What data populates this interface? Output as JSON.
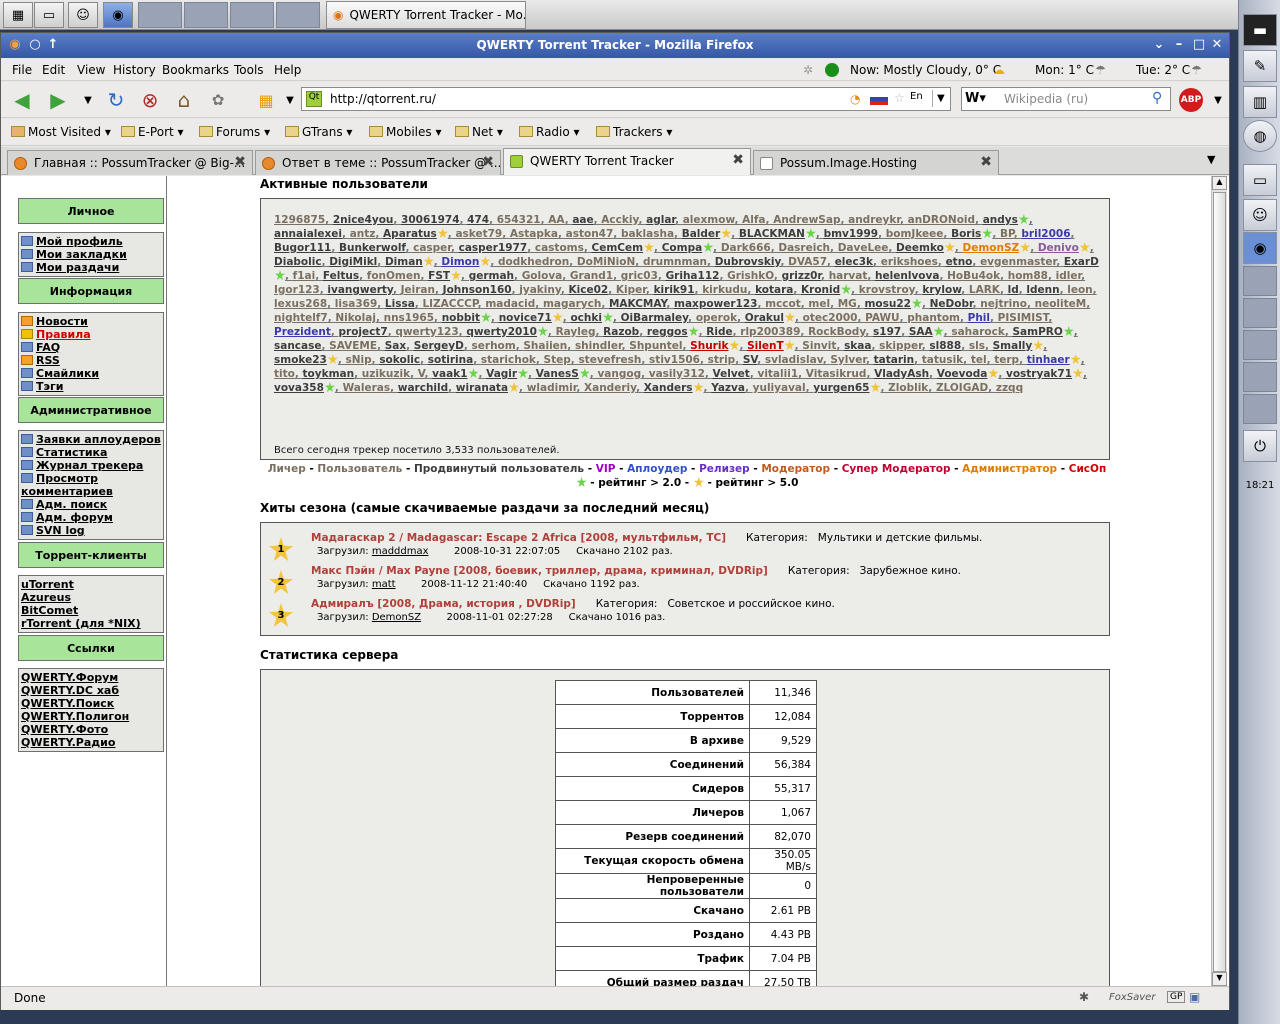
{
  "taskbar": {
    "window_label": "QWERTY Torrent Tracker - Mo..."
  },
  "window": {
    "title": "QWERTY Torrent Tracker - Mozilla Firefox"
  },
  "menu": [
    "File",
    "Edit",
    "View",
    "History",
    "Bookmarks",
    "Tools",
    "Help"
  ],
  "weather": {
    "now": "Now: Mostly Cloudy, 0° C",
    "mon": "Mon: 1° C",
    "tue": "Tue: 2° C"
  },
  "nav": {
    "url": "http://qtorrent.ru/",
    "search_placeholder": "Wikipedia (ru)"
  },
  "bookmarks": [
    "Most Visited",
    "E-Port",
    "Forums",
    "GTrans",
    "Mobiles",
    "Net",
    "Radio",
    "Trackers"
  ],
  "tabs": [
    {
      "label": "Главная :: PossumTracker @ Big-..."
    },
    {
      "label": "Ответ в теме :: PossumTracker @ ..."
    },
    {
      "label": "QWERTY Torrent Tracker"
    },
    {
      "label": "Possum.Image.Hosting"
    }
  ],
  "sidebar": {
    "sections": [
      {
        "title": "Личное",
        "items": [
          "Мой профиль",
          "Мои закладки",
          "Мои раздачи"
        ]
      },
      {
        "title": "Информация",
        "items": [
          "Новости",
          "Правила",
          "FAQ",
          "RSS",
          "Смайлики",
          "Тэги"
        ]
      },
      {
        "title": "Административное",
        "items": [
          "Заявки аплоудеров",
          "Статистика",
          "Журнал трекера",
          "Просмотр",
          "комментариев",
          "Адм. поиск",
          "Адм. форум",
          "SVN log"
        ]
      },
      {
        "title": "Торрент-клиенты",
        "items": [
          "uTorrent",
          "Azureus",
          "BitComet",
          "rTorrent (для *NIX)"
        ]
      },
      {
        "title": "Ссылки",
        "items": [
          "QWERTY.Форум",
          "QWERTY.DC хаб",
          "QWERTY.Поиск",
          "QWERTY.Полигон",
          "QWERTY.Фото",
          "QWERTY.Радио"
        ]
      }
    ]
  },
  "active_users": {
    "heading": "Активные пользователи",
    "users": [
      [
        "1296875",
        "g"
      ],
      [
        "2nice4you",
        "k"
      ],
      [
        "30061974",
        "k"
      ],
      [
        "474",
        "k"
      ],
      [
        "654321",
        "g"
      ],
      [
        "AA",
        "g"
      ],
      [
        "aae",
        "k"
      ],
      [
        "Acckiy",
        "g"
      ],
      [
        "aglar",
        "k"
      ],
      [
        "alexmow",
        "g"
      ],
      [
        "Alfa",
        "g"
      ],
      [
        "AndrewSap",
        "g"
      ],
      [
        "andreykr",
        "g"
      ],
      [
        "anDRONoid",
        "g"
      ],
      [
        "andys",
        "k"
      ],
      [
        "annaialexei",
        "k"
      ],
      [
        "antz",
        "g"
      ],
      [
        "Aparatus",
        "k"
      ],
      [
        "asket79",
        "g"
      ],
      [
        "Astapka",
        "g"
      ],
      [
        "aston47",
        "g"
      ],
      [
        "baklasha",
        "g"
      ],
      [
        "Balder",
        "k"
      ],
      [
        "BLACKMAN",
        "k"
      ],
      [
        "bmv1999",
        "k"
      ],
      [
        "bomJkeee",
        "g"
      ],
      [
        "Boris",
        "k"
      ],
      [
        "BP",
        "g"
      ],
      [
        "bril2006",
        "b"
      ],
      [
        "Bugor111",
        "k"
      ],
      [
        "Bunkerwolf",
        "k"
      ],
      [
        "casper",
        "g"
      ],
      [
        "casper1977",
        "k"
      ],
      [
        "castoms",
        "g"
      ],
      [
        "CemCem",
        "k"
      ],
      [
        "Compa",
        "k"
      ],
      [
        "Dark666",
        "g"
      ],
      [
        "Dasreich",
        "g"
      ],
      [
        "DaveLee",
        "g"
      ],
      [
        "Deemko",
        "k"
      ],
      [
        "DemonSZ",
        "o"
      ],
      [
        "Denivo",
        "v"
      ],
      [
        "Diabolic",
        "k"
      ],
      [
        "DigiMikl",
        "k"
      ],
      [
        "Diman",
        "k"
      ],
      [
        "Dimon",
        "b"
      ],
      [
        "dodkhedron",
        "g"
      ],
      [
        "DoMiNioN",
        "g"
      ],
      [
        "drumnman",
        "g"
      ],
      [
        "Dubrovskiy",
        "k"
      ],
      [
        "DVA57",
        "g"
      ],
      [
        "elec3k",
        "k"
      ],
      [
        "erikshoes",
        "g"
      ],
      [
        "etno",
        "k"
      ],
      [
        "evgenmaster",
        "g"
      ],
      [
        "ExarD",
        "k"
      ],
      [
        "f1ai",
        "g"
      ],
      [
        "Feltus",
        "k"
      ],
      [
        "fonOmen",
        "g"
      ],
      [
        "FST",
        "k"
      ],
      [
        "germah",
        "k"
      ],
      [
        "Golova",
        "g"
      ],
      [
        "Grand1",
        "g"
      ],
      [
        "gric03",
        "g"
      ],
      [
        "Griha112",
        "k"
      ],
      [
        "GrishkO",
        "g"
      ],
      [
        "grizz0r",
        "k"
      ],
      [
        "harvat",
        "g"
      ],
      [
        "helenlvova",
        "k"
      ],
      [
        "HoBu4ok",
        "g"
      ],
      [
        "hom88",
        "g"
      ],
      [
        "idler",
        "g"
      ],
      [
        "Igor123",
        "g"
      ],
      [
        "ivangwerty",
        "k"
      ],
      [
        "Jeiran",
        "g"
      ],
      [
        "Johnson160",
        "k"
      ],
      [
        "jyakiny",
        "g"
      ],
      [
        "Kice02",
        "k"
      ],
      [
        "Kiper",
        "g"
      ],
      [
        "kirik91",
        "k"
      ],
      [
        "kirkudu",
        "g"
      ],
      [
        "kotara",
        "k"
      ],
      [
        "Kronid",
        "k"
      ],
      [
        "krovstroy",
        "g"
      ],
      [
        "krylow",
        "k"
      ],
      [
        "LARK",
        "g"
      ],
      [
        "ld",
        "k"
      ],
      [
        "ldenn",
        "k"
      ],
      [
        "leon",
        "g"
      ],
      [
        "lexus268",
        "g"
      ],
      [
        "lisa369",
        "g"
      ],
      [
        "Lissa",
        "k"
      ],
      [
        "LIZACCCP",
        "g"
      ],
      [
        "madacid",
        "g"
      ],
      [
        "magarych",
        "g"
      ],
      [
        "MAKCMAY",
        "k"
      ],
      [
        "maxpower123",
        "k"
      ],
      [
        "mccot",
        "g"
      ],
      [
        "mel",
        "g"
      ],
      [
        "MG",
        "g"
      ],
      [
        "mosu22",
        "k"
      ],
      [
        "NeDobr",
        "k"
      ],
      [
        "nejtrino",
        "g"
      ],
      [
        "neoliteM",
        "g"
      ],
      [
        "nightelf7",
        "g"
      ],
      [
        "Nikolaj",
        "g"
      ],
      [
        "nns1965",
        "g"
      ],
      [
        "nobbit",
        "k"
      ],
      [
        "novice71",
        "k"
      ],
      [
        "ochki",
        "k"
      ],
      [
        "OiBarmaley",
        "k"
      ],
      [
        "operok",
        "g"
      ],
      [
        "Orakul",
        "k"
      ],
      [
        "otec2000",
        "g"
      ],
      [
        "PAWU",
        "g"
      ],
      [
        "phantom",
        "g"
      ],
      [
        "Phil",
        "b"
      ],
      [
        "PISIMIST",
        "g"
      ],
      [
        "Prezident",
        "b"
      ],
      [
        "project7",
        "k"
      ],
      [
        "qwerty123",
        "g"
      ],
      [
        "qwerty2010",
        "k"
      ],
      [
        "Rayleg",
        "g"
      ],
      [
        "Razob",
        "k"
      ],
      [
        "reggos",
        "k"
      ],
      [
        "Ride",
        "k"
      ],
      [
        "rlp200389",
        "g"
      ],
      [
        "RockBody",
        "g"
      ],
      [
        "s197",
        "k"
      ],
      [
        "SAA",
        "k"
      ],
      [
        "saharock",
        "g"
      ],
      [
        "SamPRO",
        "k"
      ],
      [
        "sancase",
        "k"
      ],
      [
        "SAVEME",
        "g"
      ],
      [
        "Sax",
        "k"
      ],
      [
        "SergeyD",
        "k"
      ],
      [
        "serhom",
        "g"
      ],
      [
        "Shaiien",
        "g"
      ],
      [
        "shindler",
        "g"
      ],
      [
        "Shpuntel",
        "g"
      ],
      [
        "Shurik",
        "rd"
      ],
      [
        "SilenT",
        "rd"
      ],
      [
        "Sinvit",
        "g"
      ],
      [
        "skaa",
        "k"
      ],
      [
        "skipper",
        "g"
      ],
      [
        "sl888",
        "k"
      ],
      [
        "sls",
        "g"
      ],
      [
        "Smally",
        "k"
      ],
      [
        "smoke23",
        "k"
      ],
      [
        "sNip",
        "g"
      ],
      [
        "sokolic",
        "k"
      ],
      [
        "sotirina",
        "k"
      ],
      [
        "starichok",
        "g"
      ],
      [
        "Step",
        "g"
      ],
      [
        "stevefresh",
        "g"
      ],
      [
        "stiv1506",
        "g"
      ],
      [
        "strip",
        "g"
      ],
      [
        "SV",
        "k"
      ],
      [
        "svladislav",
        "g"
      ],
      [
        "Sylver",
        "g"
      ],
      [
        "tatarin",
        "k"
      ],
      [
        "tatusik",
        "g"
      ],
      [
        "tel",
        "g"
      ],
      [
        "terp",
        "g"
      ],
      [
        "tinhaer",
        "b"
      ],
      [
        "tito",
        "g"
      ],
      [
        "toykman",
        "k"
      ],
      [
        "uzikuzik",
        "g"
      ],
      [
        "V",
        "g"
      ],
      [
        "vaak1",
        "k"
      ],
      [
        "Vagir",
        "k"
      ],
      [
        "VanesS",
        "k"
      ],
      [
        "vangog",
        "g"
      ],
      [
        "vasily312",
        "g"
      ],
      [
        "Velvet",
        "k"
      ],
      [
        "vitalii1",
        "g"
      ],
      [
        "Vitasikrud",
        "g"
      ],
      [
        "VladyAsh",
        "k"
      ],
      [
        "Voevoda",
        "k"
      ],
      [
        "vostryak71",
        "k"
      ],
      [
        "vova358",
        "k"
      ],
      [
        "Waleras",
        "g"
      ],
      [
        "warchild",
        "k"
      ],
      [
        "wiranata",
        "k"
      ],
      [
        "wladimir",
        "g"
      ],
      [
        "Xanderiy",
        "g"
      ],
      [
        "Xanders",
        "k"
      ],
      [
        "Yazva",
        "k"
      ],
      [
        "yuliyaval",
        "g"
      ],
      [
        "yurgen65",
        "k"
      ],
      [
        "Zloblik",
        "g"
      ],
      [
        "ZLOIGAD",
        "g"
      ],
      [
        "zzqq",
        "g"
      ]
    ],
    "total": "Всего сегодня трекер посетило 3,533 пользователей."
  },
  "legend": {
    "roles": [
      [
        "Личер",
        "#7a6f60"
      ],
      [
        "Пользователь",
        "#7a6f60"
      ],
      [
        "Продвинутый пользователь",
        "#3d3d3d"
      ],
      [
        "VIP",
        "#a000c8"
      ],
      [
        "Аплоудер",
        "#2f50c8"
      ],
      [
        "Релизер",
        "#6a2bd0"
      ],
      [
        "Модератор",
        "#c05a20"
      ],
      [
        "Супер Модератор",
        "#c00030"
      ],
      [
        "Администратор",
        "#e07a00"
      ],
      [
        "СисОп",
        "#d00000"
      ]
    ],
    "rating1": "- рейтинг > 2.0 -",
    "rating2": "- рейтинг > 5.0"
  },
  "hits": {
    "heading": "Хиты сезона (самые скачиваемые раздачи за последний месяц)",
    "items": [
      {
        "rank": "1",
        "title": "Мадагаскар 2 / Madagascar: Escape 2 Africa [2008, мультфильм, TC]",
        "cat_label": "Категория:",
        "category": "Мультики и детские фильмы.",
        "up_label": "Загрузил:",
        "uploader": "madddmax",
        "date": "2008-10-31 22:07:05",
        "downloads": "Скачано 2102 раз."
      },
      {
        "rank": "2",
        "title": "Макс Пэйн / Max Payne [2008, боевик, триллер, драма, криминал, DVDRip]",
        "cat_label": "Категория:",
        "category": "Зарубежное кино.",
        "up_label": "Загрузил:",
        "uploader": "matt",
        "date": "2008-11-12 21:40:40",
        "downloads": "Скачано 1192 раз."
      },
      {
        "rank": "3",
        "title": "Адмиралъ [2008, Драма, история , DVDRip]",
        "cat_label": "Категория:",
        "category": "Советское и российское кино.",
        "up_label": "Загрузил:",
        "uploader": "DemonSZ",
        "date": "2008-11-01 02:27:28",
        "downloads": "Скачано 1016 раз."
      }
    ]
  },
  "stats": {
    "heading": "Статистика сервера",
    "rows": [
      [
        "Пользователей",
        "11,346"
      ],
      [
        "Торрентов",
        "12,084"
      ],
      [
        "В архиве",
        "9,529"
      ],
      [
        "Соединений",
        "56,384"
      ],
      [
        "Сидеров",
        "55,317"
      ],
      [
        "Личеров",
        "1,067"
      ],
      [
        "Резерв соединений",
        "82,070"
      ],
      [
        "Текущая скорость обмена",
        "350.05 MB/s"
      ],
      [
        "Непроверенные пользователи",
        "0"
      ],
      [
        "Скачано",
        "2.61 PB"
      ],
      [
        "Роздано",
        "4.43 PB"
      ],
      [
        "Трафик",
        "7.04 PB"
      ],
      [
        "Общий размер раздач",
        "27.50 TB"
      ]
    ]
  },
  "status": {
    "text": "Done",
    "foxsaver": "FoxSaver",
    "gp": "GP"
  },
  "clock": "18:21"
}
